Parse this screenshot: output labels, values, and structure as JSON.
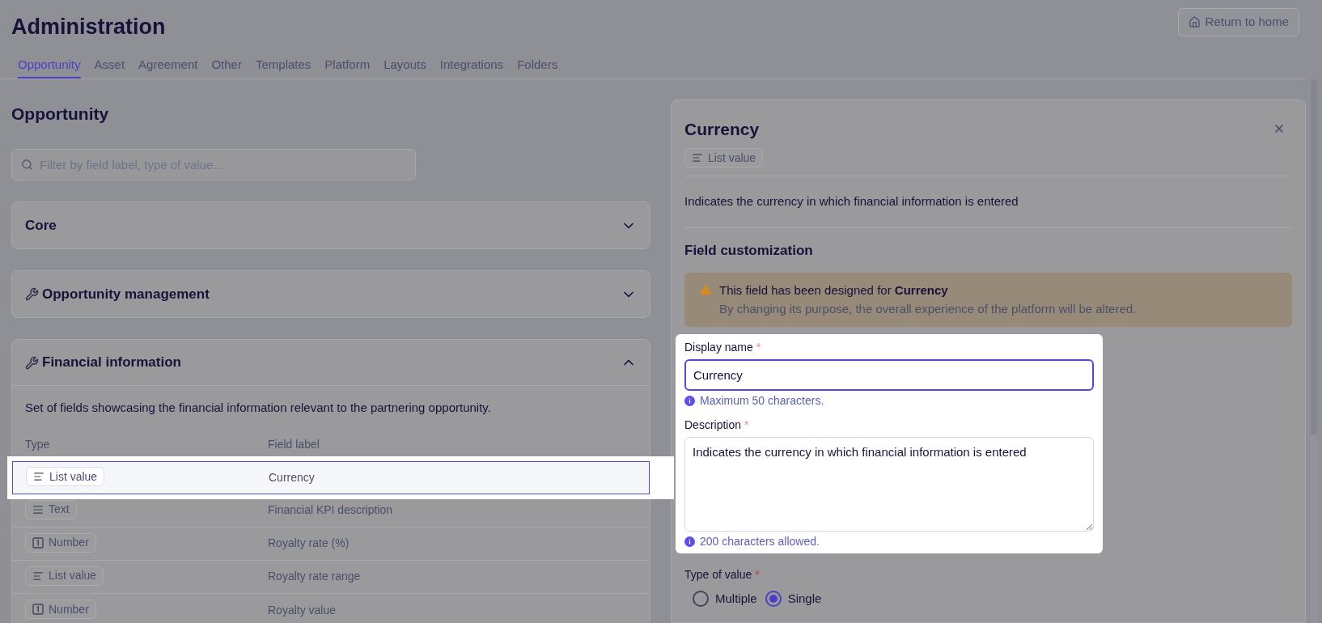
{
  "header": {
    "title": "Administration",
    "return_button": "Return to home"
  },
  "tabs": [
    {
      "label": "Opportunity",
      "selected": true
    },
    {
      "label": "Asset",
      "selected": false
    },
    {
      "label": "Agreement",
      "selected": false
    },
    {
      "label": "Other",
      "selected": false
    },
    {
      "label": "Templates",
      "selected": false
    },
    {
      "label": "Platform",
      "selected": false
    },
    {
      "label": "Layouts",
      "selected": false
    },
    {
      "label": "Integrations",
      "selected": false
    },
    {
      "label": "Folders",
      "selected": false
    }
  ],
  "page_title": "Opportunity",
  "search": {
    "placeholder": "Filter by field label, type of value..."
  },
  "sections": [
    {
      "title": "Core",
      "tools_icon": false,
      "expanded": false
    },
    {
      "title": "Opportunity management",
      "tools_icon": true,
      "expanded": false
    },
    {
      "title": "Financial information",
      "tools_icon": true,
      "expanded": true,
      "description": "Set of fields showcasing the financial information relevant to the partnering opportunity.",
      "columns": [
        "Type",
        "Field label"
      ],
      "rows": [
        {
          "kind": "list",
          "type": "List value",
          "label": "Currency",
          "selected": true
        },
        {
          "kind": "text",
          "type": "Text",
          "label": "Financial KPI description",
          "selected": false
        },
        {
          "kind": "number",
          "type": "Number",
          "label": "Royalty rate (%)",
          "selected": false
        },
        {
          "kind": "list",
          "type": "List value",
          "label": "Royalty rate range",
          "selected": false
        },
        {
          "kind": "number",
          "type": "Number",
          "label": "Royalty value",
          "selected": false
        }
      ]
    }
  ],
  "detail_panel": {
    "title": "Currency",
    "badge": {
      "kind": "list",
      "label": "List value"
    },
    "description": "Indicates the currency in which financial information is entered",
    "section_title": "Field customization",
    "warning": {
      "title": "This field has been designed for **Currency**",
      "text": "By changing its purpose, the overall experience of the platform will be altered."
    },
    "display_name": {
      "label": "Display name",
      "required": "*",
      "value": "Currency",
      "focused": true,
      "hint": "Maximum 50 characters."
    },
    "description_field": {
      "label": "Description",
      "required": "*",
      "value": "Indicates the currency in which financial information is entered",
      "hint": "200 characters allowed."
    },
    "type_of_value": {
      "label": "Type of value",
      "required": "*",
      "options": [
        {
          "label": "Multiple",
          "selected": false
        },
        {
          "label": "Single",
          "selected": true
        }
      ]
    }
  }
}
